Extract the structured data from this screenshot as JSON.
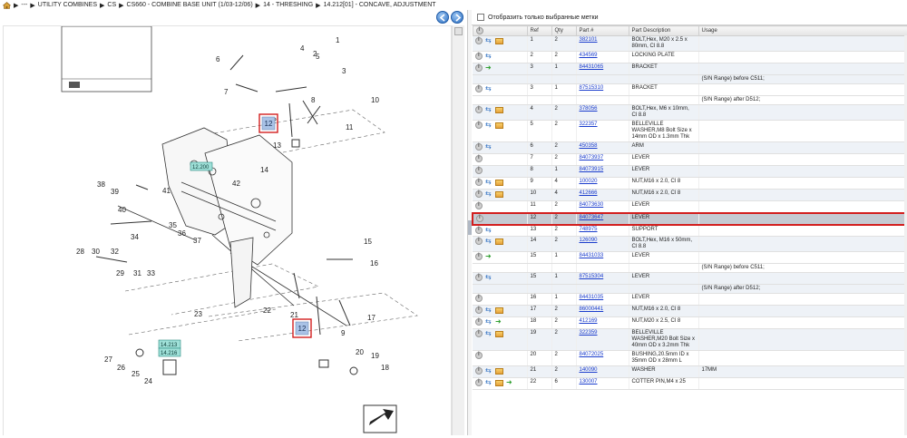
{
  "breadcrumb": {
    "items": [
      "---",
      "UTILITY COMBINES",
      "CS",
      "CS660 - COMBINE BASE UNIT (1/03-12/06)",
      "14 - THRESHING",
      "14.212[01] - CONCAVE, ADJUSTMENT"
    ]
  },
  "filter": {
    "label": "Отобразить только выбранные метки"
  },
  "table": {
    "columns": [
      "",
      "Ref",
      "Qty",
      "Part #",
      "Part Description",
      "Usage"
    ],
    "rows": [
      {
        "ref": "1",
        "qty": "2",
        "part": "382101",
        "desc": "BOLT,Hex, M20 x 2.5 x 80mm, Cl 8.8",
        "usage": "",
        "icons": [
          "swap",
          "pack"
        ],
        "alt": true
      },
      {
        "ref": "2",
        "qty": "2",
        "part": "434569",
        "desc": "LOCKING PLATE",
        "usage": "",
        "icons": [
          "swap"
        ],
        "alt": false
      },
      {
        "ref": "3",
        "qty": "1",
        "part": "84431065",
        "desc": "BRACKET",
        "usage": "",
        "icons": [
          "recycle"
        ],
        "alt": true
      },
      {
        "ref": "",
        "qty": "",
        "part": "",
        "desc": "",
        "usage": "(S/N Range) before C511;",
        "icons": [],
        "alt": true,
        "note": true
      },
      {
        "ref": "3",
        "qty": "1",
        "part": "87515310",
        "desc": "BRACKET",
        "usage": "",
        "icons": [
          "swap"
        ],
        "alt": false
      },
      {
        "ref": "",
        "qty": "",
        "part": "",
        "desc": "",
        "usage": "(S/N Range) after D512;",
        "icons": [],
        "alt": false,
        "note": true
      },
      {
        "ref": "4",
        "qty": "2",
        "part": "378056",
        "desc": "BOLT,Hex, M6 x 10mm, Cl 8.8",
        "usage": "",
        "icons": [
          "swap",
          "pack"
        ],
        "alt": true
      },
      {
        "ref": "5",
        "qty": "2",
        "part": "322357",
        "desc": "BELLEVILLE WASHER,M8 Bolt Size x 14mm OD x 1.3mm Thk",
        "usage": "",
        "icons": [
          "swap",
          "pack"
        ],
        "alt": false
      },
      {
        "ref": "6",
        "qty": "2",
        "part": "450358",
        "desc": "ARM",
        "usage": "",
        "icons": [
          "swap"
        ],
        "alt": true
      },
      {
        "ref": "7",
        "qty": "2",
        "part": "84073937",
        "desc": "LEVER",
        "usage": "",
        "icons": [],
        "alt": false
      },
      {
        "ref": "8",
        "qty": "1",
        "part": "84073915",
        "desc": "LEVER",
        "usage": "",
        "icons": [],
        "alt": true
      },
      {
        "ref": "9",
        "qty": "4",
        "part": "100020",
        "desc": "NUT,M16 x 2.0, Cl 8",
        "usage": "",
        "icons": [
          "swap",
          "pack"
        ],
        "alt": false
      },
      {
        "ref": "10",
        "qty": "4",
        "part": "412666",
        "desc": "NUT,M16 x 2.0, Cl 8",
        "usage": "",
        "icons": [
          "swap",
          "pack"
        ],
        "alt": true
      },
      {
        "ref": "11",
        "qty": "2",
        "part": "84073630",
        "desc": "LEVER",
        "usage": "",
        "icons": [],
        "alt": false
      },
      {
        "ref": "12",
        "qty": "2",
        "part": "84073647",
        "desc": "LEVER",
        "usage": "",
        "icons": [],
        "alt": false,
        "highlight": true
      },
      {
        "ref": "13",
        "qty": "2",
        "part": "748975",
        "desc": "SUPPORT",
        "usage": "",
        "icons": [
          "swap"
        ],
        "alt": false
      },
      {
        "ref": "14",
        "qty": "2",
        "part": "126090",
        "desc": "BOLT,Hex, M16 x 50mm, Cl 8.8",
        "usage": "",
        "icons": [
          "swap",
          "pack"
        ],
        "alt": true
      },
      {
        "ref": "15",
        "qty": "1",
        "part": "84431033",
        "desc": "LEVER",
        "usage": "",
        "icons": [
          "recycle"
        ],
        "alt": false
      },
      {
        "ref": "",
        "qty": "",
        "part": "",
        "desc": "",
        "usage": "(S/N Range) before C511;",
        "icons": [],
        "alt": false,
        "note": true
      },
      {
        "ref": "15",
        "qty": "1",
        "part": "87515304",
        "desc": "LEVER",
        "usage": "",
        "icons": [
          "swap"
        ],
        "alt": true
      },
      {
        "ref": "",
        "qty": "",
        "part": "",
        "desc": "",
        "usage": "(S/N Range) after D512;",
        "icons": [],
        "alt": true,
        "note": true
      },
      {
        "ref": "16",
        "qty": "1",
        "part": "84431035",
        "desc": "LEVER",
        "usage": "",
        "icons": [],
        "alt": false
      },
      {
        "ref": "17",
        "qty": "2",
        "part": "86000441",
        "desc": "NUT,M16 x 2.0, Cl 8",
        "usage": "",
        "icons": [
          "swap",
          "pack"
        ],
        "alt": true
      },
      {
        "ref": "18",
        "qty": "2",
        "part": "412169",
        "desc": "NUT,M20 x 2.5, Cl 8",
        "usage": "",
        "icons": [
          "swap",
          "recycle"
        ],
        "alt": false
      },
      {
        "ref": "19",
        "qty": "2",
        "part": "322359",
        "desc": "BELLEVILLE WASHER,M20 Bolt Size x 40mm OD x 3.2mm Thk",
        "usage": "",
        "icons": [
          "swap",
          "pack"
        ],
        "alt": true
      },
      {
        "ref": "20",
        "qty": "2",
        "part": "84072025",
        "desc": "BUSHING,20.5mm ID x 35mm OD x 28mm L",
        "usage": "",
        "icons": [],
        "alt": false
      },
      {
        "ref": "21",
        "qty": "2",
        "part": "140090",
        "desc": "WASHER",
        "usage": "17MM",
        "icons": [
          "swap",
          "pack"
        ],
        "alt": true
      },
      {
        "ref": "22",
        "qty": "6",
        "part": "130007",
        "desc": "COTTER PIN,M4 x 25",
        "usage": "",
        "icons": [
          "swap",
          "pack",
          "recycle"
        ],
        "alt": false
      }
    ]
  },
  "diagram": {
    "callouts": [
      "1",
      "2",
      "3",
      "4",
      "5",
      "6",
      "7",
      "8",
      "9",
      "10",
      "11",
      "12",
      "13",
      "14",
      "15",
      "16",
      "17",
      "18",
      "19",
      "20",
      "21",
      "22",
      "23",
      "24",
      "25",
      "26",
      "27",
      "28",
      "29",
      "30",
      "31",
      "32",
      "33",
      "34",
      "35",
      "36",
      "37",
      "38",
      "39",
      "40",
      "41",
      "42"
    ],
    "ref_tags": [
      "12.200",
      "14.213",
      "14.216"
    ],
    "highlight_label": "12"
  }
}
